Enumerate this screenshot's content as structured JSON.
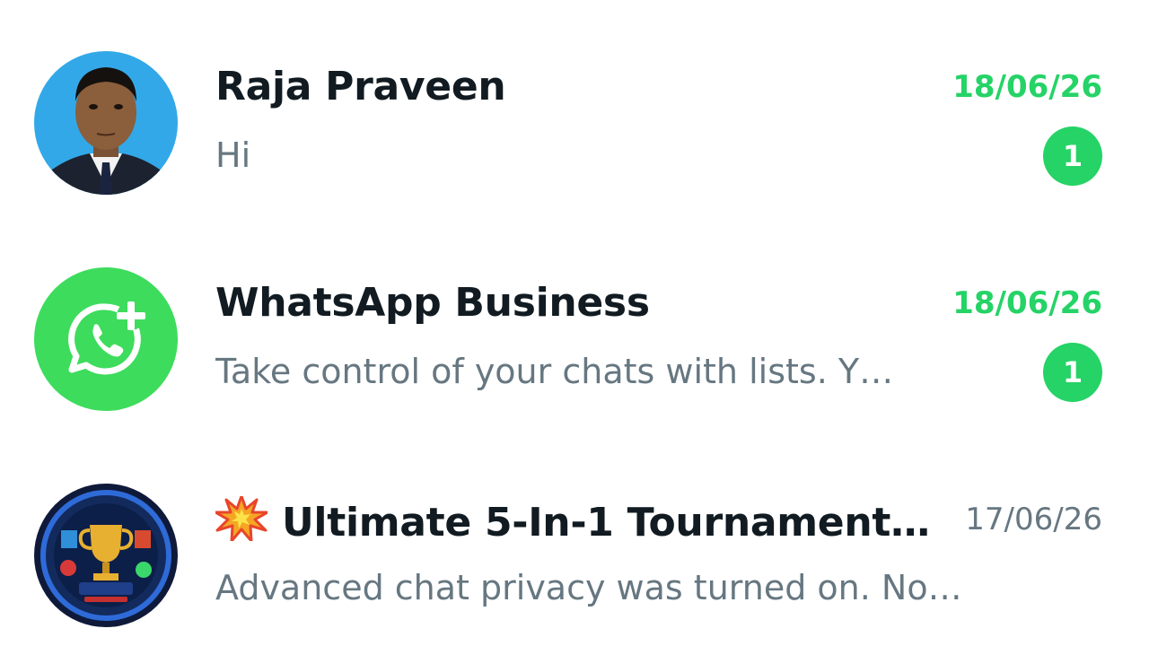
{
  "chats": [
    {
      "name": "Raja Praveen",
      "time": "18/06/26",
      "preview": "Hi",
      "unread": "1",
      "avatar": "person-photo"
    },
    {
      "name": "WhatsApp Business",
      "time": "18/06/26",
      "preview": "Take control of your chats with lists. Y…",
      "unread": "1",
      "avatar": "whatsapp-business-logo"
    },
    {
      "name": "Ultimate 5-In-1 Tournament…",
      "time": "17/06/26",
      "preview": "Advanced chat privacy was turned on. No…",
      "emoji": "collision-emoji",
      "avatar": "tournament-trophy-logo"
    }
  ],
  "colors": {
    "accent": "#25d366",
    "text_primary": "#111b21",
    "text_secondary": "#667781"
  }
}
